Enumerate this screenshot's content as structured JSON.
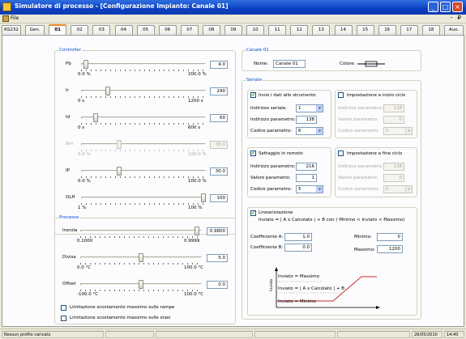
{
  "window": {
    "title": "Simulatore di processo - [Configurazione Impianto: Canale 01]"
  },
  "menu": {
    "file": "File",
    "right": "- ₽"
  },
  "tabs": [
    "RS232",
    "Gen.",
    "01",
    "02",
    "03",
    "04",
    "05",
    "06",
    "07",
    "08",
    "09",
    "10",
    "11",
    "12",
    "13",
    "14",
    "15",
    "16",
    "17",
    "18",
    "Aux."
  ],
  "active_tab": "01",
  "controller": {
    "title": "Controller",
    "sliders": [
      {
        "label": "Pb",
        "value": "4.0",
        "min": "0.0 %",
        "max": "200.0 %",
        "fraction": 0.02,
        "enabled": true
      },
      {
        "label": "Ir",
        "value": "240",
        "min": "0 s",
        "max": "1200 s",
        "fraction": 0.2,
        "enabled": true
      },
      {
        "label": "Id",
        "value": "60",
        "min": "0 s",
        "max": "600 s",
        "fraction": 0.1,
        "enabled": true
      },
      {
        "label": "Rm",
        "value": "30.0",
        "min": "0.0 %",
        "max": "100.0 %",
        "fraction": 0.3,
        "enabled": false
      },
      {
        "label": "IP",
        "value": "30.0",
        "min": "0.0 %",
        "max": "100.0 %",
        "fraction": 0.3,
        "enabled": true
      },
      {
        "label": "OLH",
        "value": "100",
        "min": "1 %",
        "max": "100 %",
        "fraction": 1.0,
        "enabled": true
      }
    ]
  },
  "process": {
    "title": "Processo",
    "sliders": [
      {
        "label": "Inerzia",
        "value": "0.9800",
        "min": "0.1000",
        "max": "0.9999",
        "fraction": 0.98
      },
      {
        "label": "Divisa",
        "value": "5.0",
        "min": "0.0 °C",
        "max": "100.0 °C",
        "fraction": 0.5
      },
      {
        "label": "Offset",
        "value": "0.0",
        "min": "-100.0 °C",
        "max": "100.0 °C",
        "fraction": 0.5
      }
    ],
    "check_ramps": "Limitazione scostamento massimo sulle rampe",
    "check_stasi": "Limitazione scostamento massimo sulle stasi"
  },
  "channel": {
    "title": "Canale 01",
    "name_label": "Nome:",
    "name_value": "Canale 01",
    "color_label": "Colore:"
  },
  "serial": {
    "title": "Seriale",
    "send": {
      "checkbox_label": "Invio i dati allo strumento",
      "checked": true,
      "serial_index_label": "Indirizzo seriale:",
      "serial_index_value": "1",
      "param_index_label": "Indirizzo parametro:",
      "param_index_value": "138",
      "param_code_label": "Codice parametro:",
      "param_code_value": "6"
    },
    "start_cycle": {
      "checkbox_label": "Impostazione a inizio ciclo",
      "checked": false,
      "param_index_label": "Indirizzo parametro:",
      "param_index_value": "138",
      "param_value_label": "Valore parametro:",
      "param_value_value": "0",
      "param_code_label": "Codice parametro:",
      "param_code_value": "0"
    },
    "remote": {
      "checkbox_label": "Settaggio in remoto",
      "checked": true,
      "param_index_label": "Indirizzo parametro:",
      "param_index_value": "216",
      "param_value_label": "Valore parametro:",
      "param_value_value": "1",
      "param_code_label": "Codice parametro:",
      "param_code_value": "5"
    },
    "end_cycle": {
      "checkbox_label": "Impostazione a fine ciclo",
      "checked": false,
      "param_index_label": "Indirizzo parametro:",
      "param_index_value": "138",
      "param_value_label": "Valore parametro:",
      "param_value_value": "0",
      "param_code_label": "Codice parametro:",
      "param_code_value": "0"
    },
    "linear": {
      "checkbox_label": "Linearizzazione",
      "checked": true,
      "formula": "Inviato = | A x Calcolato | + B   con  ( Minimo < Inviato < Massimo)",
      "coef_a_label": "Coefficiente A:",
      "coef_a_value": "1.0",
      "coef_b_label": "Coefficiente B:",
      "coef_b_value": "0.0",
      "min_label": "Minimo:",
      "min_value": "0",
      "max_label": "Massimo:",
      "max_value": "1200",
      "graph_max": "Inviato = Massimo",
      "graph_mid": "Inviato = | A x Calcolato | + B",
      "graph_min": "Inviato = Minimo",
      "graph_axis": "Inviato"
    }
  },
  "status": {
    "message": "Nessun profilo caricato",
    "date": "26/05/2010",
    "time": "14:40"
  }
}
